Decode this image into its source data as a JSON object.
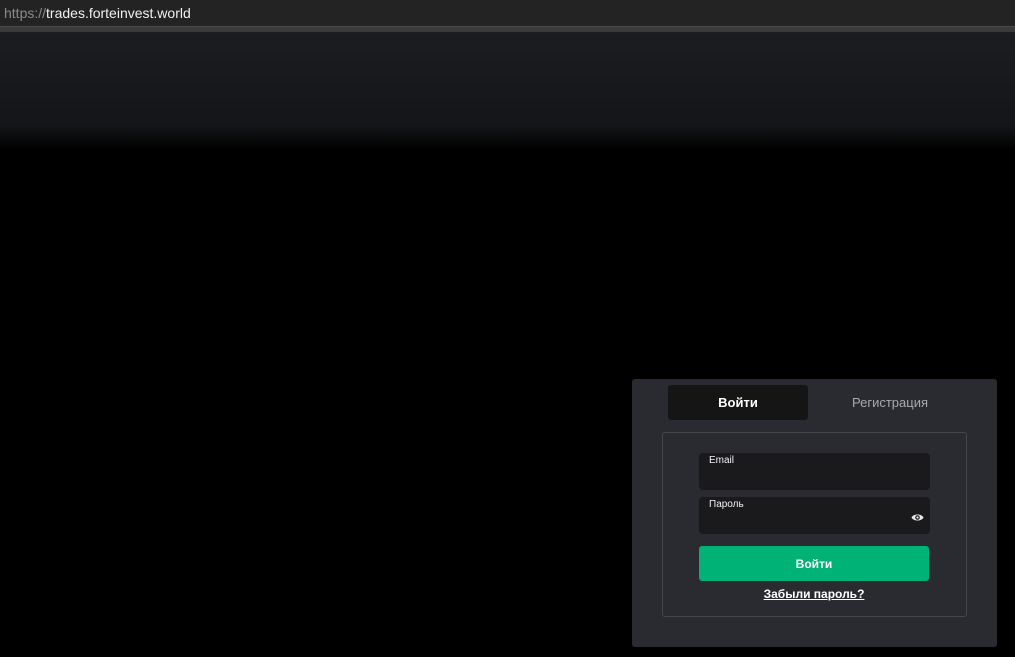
{
  "browser": {
    "url_scheme": "https://",
    "url_host": "trades.forteinvest.world"
  },
  "auth_panel": {
    "tabs": [
      {
        "label": "Войти",
        "active": true
      },
      {
        "label": "Регистрация",
        "active": false
      }
    ],
    "email": {
      "label": "Email",
      "value": ""
    },
    "password": {
      "label": "Пароль",
      "value": "",
      "toggle_icon": "eye-icon"
    },
    "submit_label": "Войти",
    "forgot_label": "Забыли пароль?"
  },
  "colors": {
    "accent": "#00b276",
    "panel_bg": "#2a2b30",
    "page_bg": "#000000"
  }
}
